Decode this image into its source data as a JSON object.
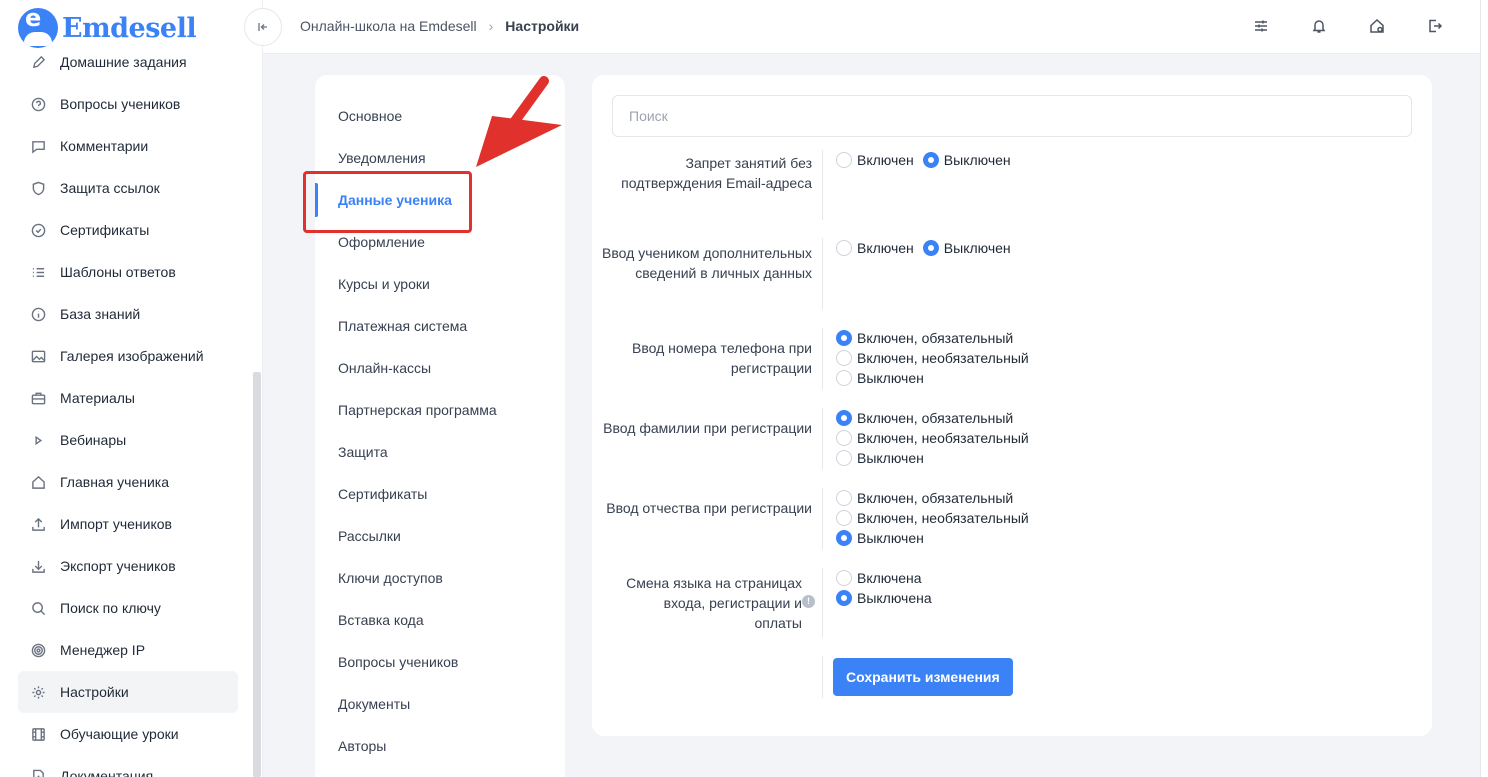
{
  "brand": {
    "name": "Emdesell",
    "logo_letter": "e"
  },
  "sidebar": {
    "items": [
      {
        "label": "Домашние задания",
        "icon": "pencil-icon"
      },
      {
        "label": "Вопросы учеников",
        "icon": "question-circle-icon"
      },
      {
        "label": "Комментарии",
        "icon": "comment-icon"
      },
      {
        "label": "Защита ссылок",
        "icon": "shield-icon"
      },
      {
        "label": "Сертификаты",
        "icon": "badge-check-icon"
      },
      {
        "label": "Шаблоны ответов",
        "icon": "list-icon"
      },
      {
        "label": "База знаний",
        "icon": "info-circle-icon"
      },
      {
        "label": "Галерея изображений",
        "icon": "image-icon"
      },
      {
        "label": "Материалы",
        "icon": "briefcase-icon"
      },
      {
        "label": "Вебинары",
        "icon": "play-icon"
      },
      {
        "label": "Главная ученика",
        "icon": "home-icon"
      },
      {
        "label": "Импорт учеников",
        "icon": "upload-icon"
      },
      {
        "label": "Экспорт учеников",
        "icon": "download-icon"
      },
      {
        "label": "Поиск по ключу",
        "icon": "search-icon"
      },
      {
        "label": "Менеджер IP",
        "icon": "target-icon"
      },
      {
        "label": "Настройки",
        "icon": "gear-icon",
        "active": true
      },
      {
        "label": "Обучающие уроки",
        "icon": "film-icon"
      },
      {
        "label": "Документация",
        "icon": "document-icon"
      }
    ]
  },
  "header": {
    "breadcrumb": [
      "Онлайн-школа на Emdesell",
      "Настройки"
    ],
    "icons": [
      "sliders-icon",
      "bell-icon",
      "home-settings-icon",
      "logout-icon"
    ]
  },
  "settings_nav": {
    "items": [
      "Основное",
      "Уведомления",
      "Данные ученика",
      "Оформление",
      "Курсы и уроки",
      "Платежная система",
      "Онлайн-кассы",
      "Партнерская программа",
      "Защита",
      "Сертификаты",
      "Рассылки",
      "Ключи доступов",
      "Вставка кода",
      "Вопросы учеников",
      "Документы",
      "Авторы"
    ],
    "active": "Данные ученика"
  },
  "form": {
    "search_placeholder": "Поиск",
    "rows": [
      {
        "label": "Запрет занятий без подтверждения Email-адреса",
        "options": [
          {
            "label": "Включен",
            "checked": false
          },
          {
            "label": "Выключен",
            "checked": true
          }
        ],
        "inline": true
      },
      {
        "label": "Ввод учеником дополнительных сведений в личных данных",
        "options": [
          {
            "label": "Включен",
            "checked": false
          },
          {
            "label": "Выключен",
            "checked": true
          }
        ],
        "inline": true
      },
      {
        "label": "Ввод номера телефона при регистрации",
        "options": [
          {
            "label": "Включен, обязательный",
            "checked": true
          },
          {
            "label": "Включен, необязательный",
            "checked": false
          },
          {
            "label": "Выключен",
            "checked": false
          }
        ]
      },
      {
        "label": "Ввод фамилии при регистрации",
        "options": [
          {
            "label": "Включен, обязательный",
            "checked": true
          },
          {
            "label": "Включен, необязательный",
            "checked": false
          },
          {
            "label": "Выключен",
            "checked": false
          }
        ]
      },
      {
        "label": "Ввод отчества при регистрации",
        "options": [
          {
            "label": "Включен, обязательный",
            "checked": false
          },
          {
            "label": "Включен, необязательный",
            "checked": false
          },
          {
            "label": "Выключен",
            "checked": true
          }
        ]
      },
      {
        "label": "Смена языка на страницах входа, регистрации и оплаты",
        "options": [
          {
            "label": "Включена",
            "checked": false
          },
          {
            "label": "Выключена",
            "checked": true
          }
        ],
        "has_info": true
      }
    ],
    "save_label": "Сохранить изменения"
  },
  "colors": {
    "accent": "#3b82f6",
    "highlight": "#e0312c"
  }
}
